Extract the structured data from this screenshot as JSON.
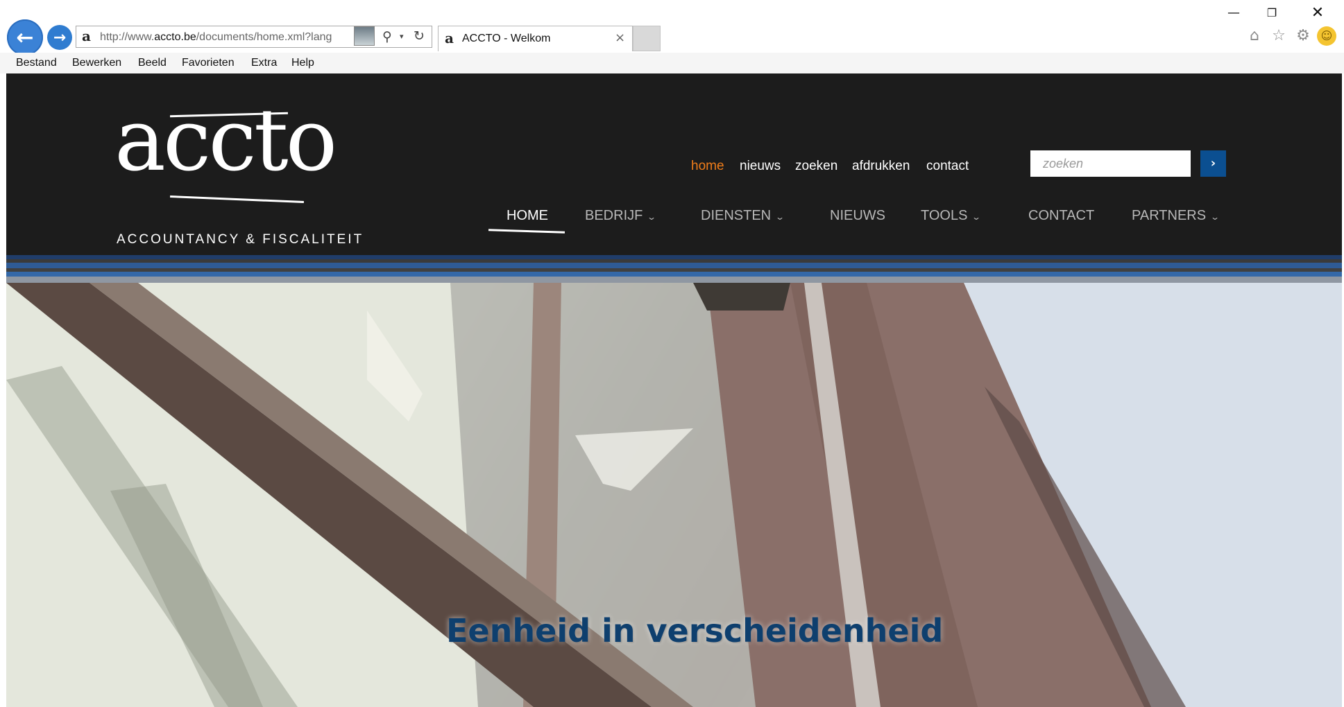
{
  "browser": {
    "address_url_prefix": "http://www.",
    "address_url_domain": "accto.be",
    "address_url_suffix": "/documents/home.xml?lang",
    "tab_title": "ACCTO - Welkom",
    "tab_close_glyph": "×",
    "favicon_glyph": "a",
    "search_glyph": "⚲",
    "dropdown_glyph": "▾",
    "refresh_glyph": "↻",
    "window_minimize_glyph": "—",
    "window_restore_glyph": "❐",
    "window_close_glyph": "✕",
    "home_glyph": "⌂",
    "star_glyph": "☆",
    "gear_glyph": "⚙",
    "smiley_glyph": "☺",
    "back_glyph": "←",
    "forward_glyph": "→"
  },
  "menubar": {
    "items": [
      "Bestand",
      "Bewerken",
      "Beeld",
      "Favorieten",
      "Extra",
      "Help"
    ]
  },
  "site": {
    "logo": {
      "word": "accto",
      "tagline": "ACCOUNTANCY & FISCALITEIT"
    },
    "top_links": [
      "home",
      "nieuws",
      "zoeken",
      "afdrukken",
      "contact"
    ],
    "search": {
      "placeholder": "zoeken",
      "button_glyph": "›"
    },
    "main_nav": [
      {
        "label": "HOME",
        "has_dropdown": false,
        "active": true
      },
      {
        "label": "BEDRIJF",
        "has_dropdown": true
      },
      {
        "label": "DIENSTEN",
        "has_dropdown": true
      },
      {
        "label": "NIEUWS",
        "has_dropdown": false
      },
      {
        "label": "TOOLS",
        "has_dropdown": true
      },
      {
        "label": "CONTACT",
        "has_dropdown": false
      },
      {
        "label": "PARTNERS",
        "has_dropdown": true
      }
    ],
    "dropdown_caret": "⌄",
    "hero": {
      "title": "Eenheid in verscheidenheid"
    },
    "colors": {
      "header_bg": "#1c1c1c",
      "active_link": "#f07d1a",
      "search_button": "#0b4f91",
      "hero_title": "#0e3f6e"
    }
  }
}
